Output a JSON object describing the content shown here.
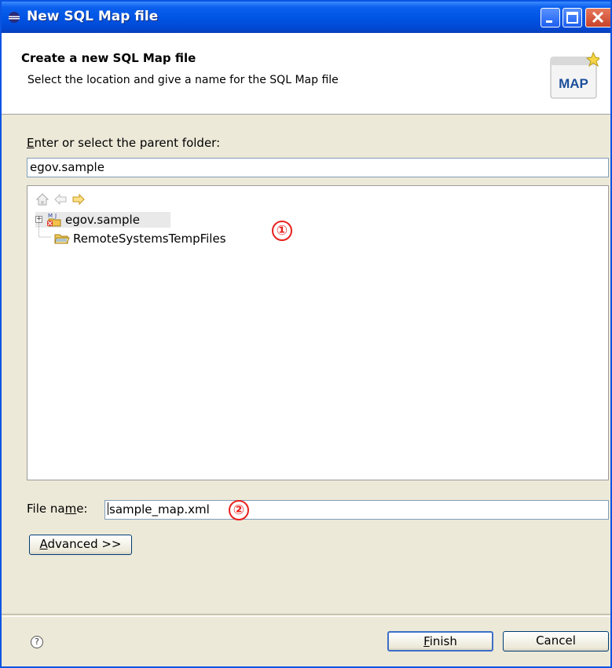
{
  "window": {
    "title": "New SQL Map file"
  },
  "header": {
    "title": "Create a new SQL Map file",
    "description": "Select the location and give a name for the SQL Map file",
    "icon_text": "MAP"
  },
  "parent_folder": {
    "label_mnemonic": "E",
    "label_rest": "nter or select the parent folder:",
    "value": "egov.sample"
  },
  "tree": {
    "toolbar": [
      "home-icon",
      "back-icon",
      "forward-icon"
    ],
    "items": [
      {
        "label": "egov.sample",
        "icon": "project-icon",
        "selected": true
      },
      {
        "label": "RemoteSystemsTempFiles",
        "icon": "folder-icon"
      }
    ]
  },
  "callouts": {
    "first": "①",
    "second": "②"
  },
  "file_name": {
    "label_before": "File na",
    "label_mnemonic": "m",
    "label_after": "e:",
    "value": "sample_map.xml"
  },
  "buttons": {
    "advanced_mnemonic": "A",
    "advanced_rest": "dvanced >>",
    "finish_mnemonic": "F",
    "finish_rest": "inish",
    "cancel": "Cancel",
    "help": "?"
  }
}
